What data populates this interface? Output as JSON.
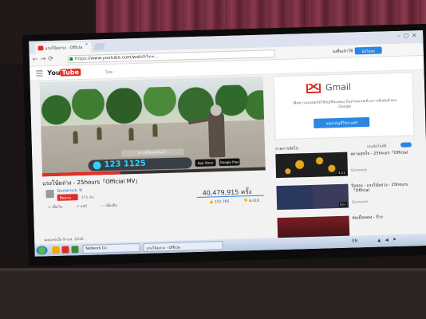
{
  "browser": {
    "tab_title": "แรงโน้มถ่วง - Officia",
    "tab_close": "×",
    "window_buttons": "–▢×",
    "nav_buttons": "←→⟳",
    "url_scheme": "https",
    "url": "://www.youtube.com/watch?v=...",
    "sign_in": "ลงชื่อเข้าใช้",
    "upload": "อัปโหลด",
    "star": "☆"
  },
  "youtube": {
    "logo_you": "You",
    "logo_tube": "Tube",
    "country": "ไทย"
  },
  "video": {
    "overlay_tag": "ดาวน์โหลดได้แล้ว",
    "overlay_number": "123 1125",
    "store_app_store": "App Store",
    "store_google_play": "Google Play",
    "progress_fraction": 0.35,
    "title": "แรงโน้มถ่วง - 25hours「Official MV」",
    "channel": "Genierock ®",
    "subscribe": "ติดตาม",
    "subscriber_count": "375 พัน",
    "views": "40,479,915 ครั้ง",
    "actions": [
      "+ เพิ่มใน",
      "↗ แชร์",
      "··· เพิ่มเติม"
    ],
    "likes": "101,785",
    "dislikes": "6,418",
    "published": "เผยแพร่เมื่อ 9 ส.ค. 2015"
  },
  "ad": {
    "brand": "Gmail",
    "text": "เพิ่มความปลอดภัยให้บัญชีของคุณ ป้องกันสแปมด้วยการยืนยันตัวตน Google",
    "button": "สมัครบัญชีใช้งานฟรี"
  },
  "sidebar": {
    "next_label": "รายการถัดไป",
    "autoplay_label": "เล่นอัตโนมัติ",
    "recommendations": [
      {
        "title": "สยามสุขใจ - 25hours「Official",
        "channel": "Genierock",
        "duration": "4:22"
      },
      {
        "title": "ปิงปอง - แรงโน้มถ่วง - 25hours「Official",
        "channel": "Genierock",
        "duration": "50+"
      },
      {
        "title": "ฝนเมื่อเพลง - ป๊าง",
        "channel": "",
        "duration": ""
      }
    ]
  },
  "taskbar": {
    "items": [
      "Network Co",
      "แรงโน้มถ่วง - Officia"
    ],
    "language": "EN",
    "tray": "▲ ◀ ⚑"
  },
  "warning_mark": "!",
  "colors": {
    "youtube_red": "#e52d27",
    "link_blue": "#2b87e3",
    "overlay_cyan": "#2ed1ff",
    "gmail_red": "#d93025"
  }
}
